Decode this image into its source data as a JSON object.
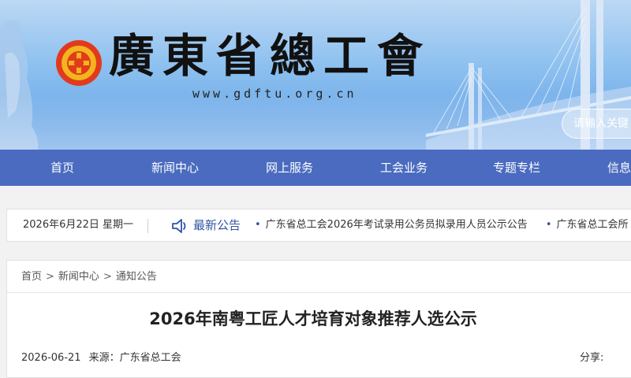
{
  "header": {
    "logo_title": "廣東省總工會",
    "logo_url": "www.gdftu.org.cn",
    "search_placeholder": "请输入关键"
  },
  "nav": {
    "items": [
      {
        "label": "首页"
      },
      {
        "label": "新闻中心"
      },
      {
        "label": "网上服务"
      },
      {
        "label": "工会业务"
      },
      {
        "label": "专题专栏"
      },
      {
        "label": "信息"
      }
    ]
  },
  "infobar": {
    "date": "2026年6月22日 星期一",
    "notice_label": "最新公告",
    "notices": [
      "广东省总工会2026年考试录用公务员拟录用人员公示公告",
      "广东省总工会所"
    ]
  },
  "article": {
    "breadcrumb": [
      "首页",
      "新闻中心",
      "通知公告"
    ],
    "breadcrumb_sep": ">",
    "title": "2026年南粤工匠人才培育对象推荐人选公示",
    "date": "2026-06-21",
    "source": "来源：广东省总工会",
    "share_label": "分享:"
  },
  "colors": {
    "nav_bg": "#4a6bbf",
    "accent": "#2f55a4",
    "emblem_red": "#e23a1d",
    "emblem_gold": "#f2b51d"
  }
}
